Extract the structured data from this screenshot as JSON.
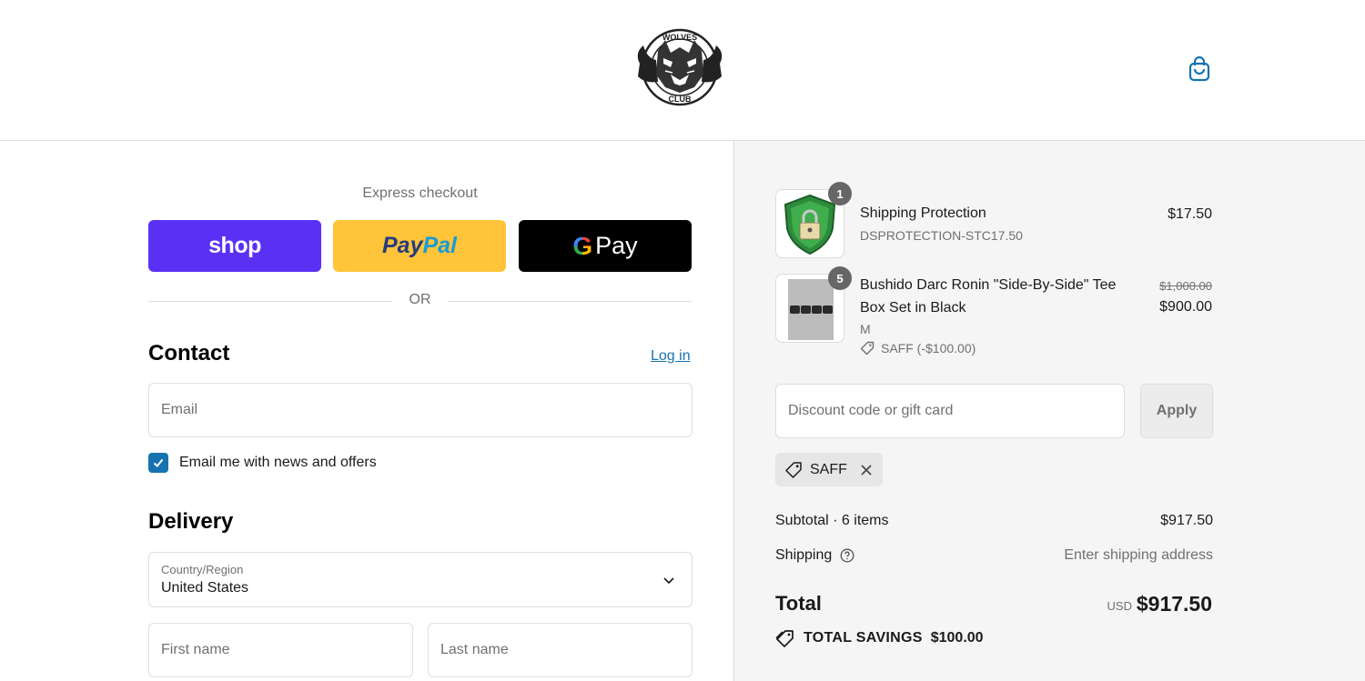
{
  "header": {
    "logo_text_top": "WOLVES",
    "logo_text_bottom": "CLUB",
    "cart_icon": "shopping-bag-icon"
  },
  "express": {
    "title": "Express checkout",
    "shop_label": "shop",
    "paypal_part1": "Pay",
    "paypal_part2": "Pal",
    "gpay_g": "G",
    "gpay_label": "Pay",
    "or_label": "OR"
  },
  "contact": {
    "title": "Contact",
    "login_label": "Log in",
    "email_placeholder": "Email",
    "newsletter_label": "Email me with news and offers",
    "newsletter_checked": true
  },
  "delivery": {
    "title": "Delivery",
    "country_label": "Country/Region",
    "country_value": "United States",
    "first_name_placeholder": "First name",
    "last_name_placeholder": "Last name"
  },
  "order": {
    "items": [
      {
        "name": "Shipping Protection",
        "sub": "DSPROTECTION-STC17.50",
        "quantity": "1",
        "price": "$17.50"
      },
      {
        "name_line1": "Bushido Darc Ronin \"Side-By-Side\" Tee",
        "name_line2": "Box Set in Black",
        "variant": "M",
        "discount": "SAFF (-$100.00)",
        "quantity": "5",
        "compare_price": "$1,000.00",
        "price": "$900.00"
      }
    ],
    "discount_placeholder": "Discount code or gift card",
    "apply_label": "Apply",
    "applied_code": "SAFF",
    "subtotal_label": "Subtotal · 6 items",
    "subtotal_value": "$917.50",
    "shipping_label": "Shipping",
    "shipping_value": "Enter shipping address",
    "total_label": "Total",
    "total_currency": "USD",
    "total_value": "$917.50",
    "savings_label": "TOTAL SAVINGS",
    "savings_value": "$100.00"
  },
  "colors": {
    "accent": "#1773b0",
    "shop": "#5a31f4",
    "paypal": "#ffc439",
    "gpay": "#000000",
    "summary_bg": "#f5f5f5"
  }
}
